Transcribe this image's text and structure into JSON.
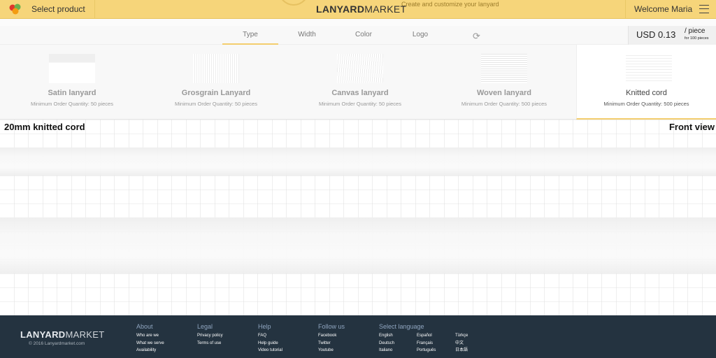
{
  "header": {
    "select_product": "Select product",
    "tagline": "Create and customize your lanyard",
    "brand_bold": "LANYARD",
    "brand_light": "MARKET",
    "welcome": "Welcome Maria",
    "accent": "#f6d57a"
  },
  "tabs": [
    "Type",
    "Width",
    "Color",
    "Logo"
  ],
  "price": {
    "amount": "USD 0.13",
    "per": "/ piece",
    "note": "for 100 pieces"
  },
  "products": [
    {
      "name": "Satin lanyard",
      "moq": "Minimum Order Quantity: 50 pieces"
    },
    {
      "name": "Grosgrain Lanyard",
      "moq": "Minimum Order Quantity: 50 pieces"
    },
    {
      "name": "Canvas lanyard",
      "moq": "Minimum Order Quantity: 50 pieces"
    },
    {
      "name": "Woven lanyard",
      "moq": "Minimum Order Quantity: 500 pieces"
    },
    {
      "name": "Knitted cord",
      "moq": "Minimum Order Quantity: 500 pieces",
      "selected": true
    }
  ],
  "preview": {
    "title": "20mm knitted cord",
    "view": "Front view"
  },
  "footer": {
    "brand_bold": "LANYARD",
    "brand_light": "MARKET",
    "copyright": "© 2016 Lanyardmarket.com",
    "columns": [
      {
        "title": "About",
        "links": [
          "Who are we",
          "What we serve",
          "Availability"
        ]
      },
      {
        "title": "Legal",
        "links": [
          "Privacy policy",
          "Terms of use"
        ]
      },
      {
        "title": "Help",
        "links": [
          "FAQ",
          "Help guide",
          "Video tutorial"
        ]
      },
      {
        "title": "Follow us",
        "links": [
          "Facebook",
          "Twitter",
          "Youtube"
        ]
      },
      {
        "title": "Select language",
        "links": [
          "English",
          "Deutsch",
          "Italiano"
        ]
      },
      {
        "title": "",
        "links": [
          "Español",
          "Français",
          "Português"
        ]
      },
      {
        "title": "",
        "links": [
          "Türkçe",
          "中文",
          "日本語"
        ]
      }
    ]
  }
}
